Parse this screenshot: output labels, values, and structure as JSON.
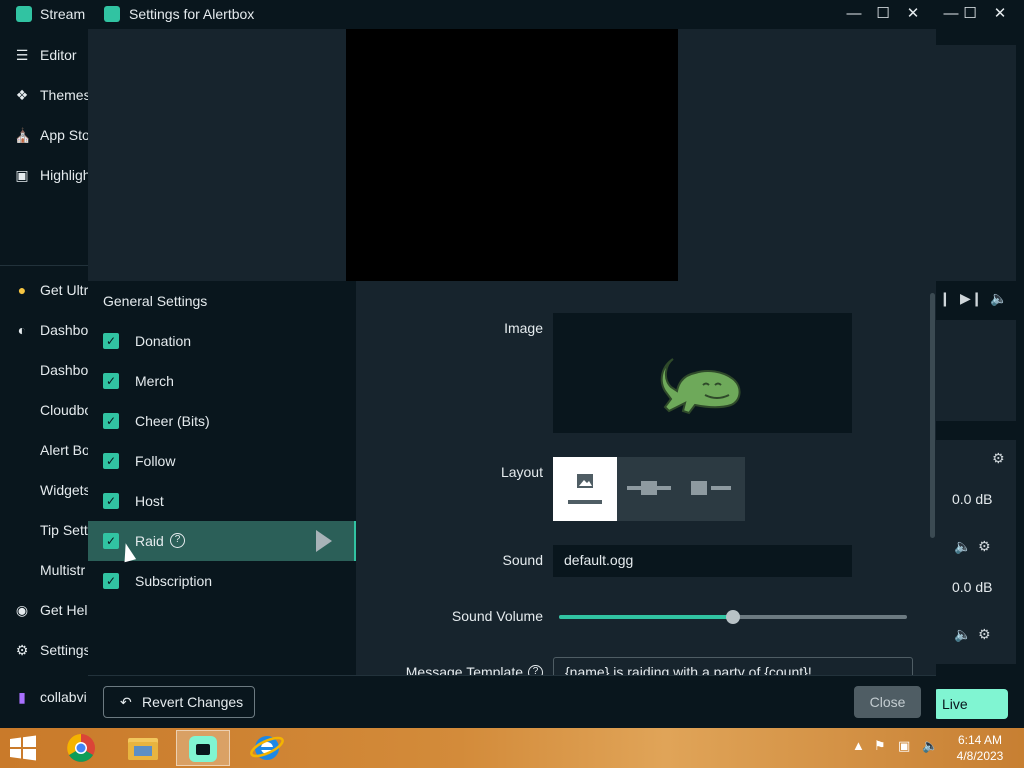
{
  "main_window": {
    "title": "Stream",
    "nav": [
      {
        "label": "Editor",
        "icon": "sliders-icon"
      },
      {
        "label": "Themes",
        "icon": "brush-icon"
      },
      {
        "label": "App Sto",
        "icon": "store-icon"
      },
      {
        "label": "Highligh",
        "icon": "film-icon"
      },
      {
        "label": "Get Ultr",
        "icon": "ultra-icon"
      },
      {
        "label": "Dashbo",
        "icon": "dashboard-icon"
      },
      {
        "label": "Dashbo"
      },
      {
        "label": "Cloudbo"
      },
      {
        "label": "Alert Bo"
      },
      {
        "label": "Widgets"
      },
      {
        "label": "Tip Sett"
      },
      {
        "label": "Multistr"
      },
      {
        "label": "Get Help",
        "icon": "help-icon"
      },
      {
        "label": "Settings",
        "icon": "gear-icon"
      },
      {
        "label": "collabvi",
        "icon": "twitch-icon"
      }
    ],
    "mixer": {
      "db1": "0.0 dB",
      "db2": "0.0 dB"
    },
    "go_live_label": "Live"
  },
  "dialog": {
    "title": "Settings for Alertbox",
    "list_heading": "General Settings",
    "alerts": [
      {
        "label": "Donation",
        "checked": true
      },
      {
        "label": "Merch",
        "checked": true
      },
      {
        "label": "Cheer (Bits)",
        "checked": true
      },
      {
        "label": "Follow",
        "checked": true
      },
      {
        "label": "Host",
        "checked": true
      },
      {
        "label": "Raid",
        "checked": true,
        "selected": true
      },
      {
        "label": "Subscription",
        "checked": true
      }
    ],
    "fields": {
      "image_label": "Image",
      "layout_label": "Layout",
      "sound_label": "Sound",
      "sound_value": "default.ogg",
      "sound_volume_label": "Sound Volume",
      "sound_volume_percent": 50,
      "message_template_label": "Message Template",
      "message_template_value": "{name} is raiding with a party of {count}!"
    },
    "footer": {
      "revert_label": "Revert Changes",
      "close_label": "Close"
    }
  },
  "taskbar": {
    "time": "6:14 AM",
    "date": "4/8/2023"
  },
  "colors": {
    "accent": "#31c3a2",
    "go_live": "#80f5d2",
    "panel_dark": "#09161d",
    "panel": "#17242d"
  }
}
